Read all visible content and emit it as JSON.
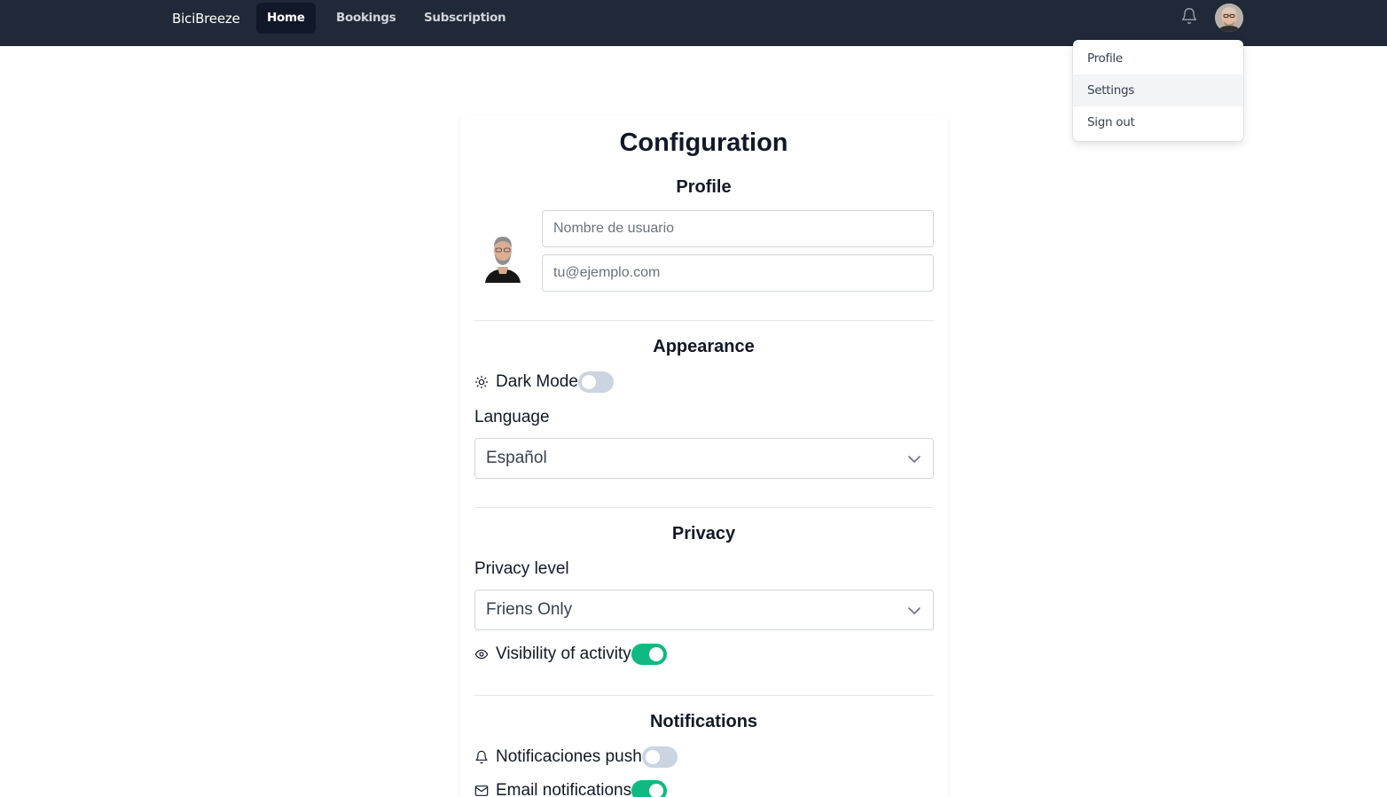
{
  "navbar": {
    "brand": "BiciBreeze",
    "links": [
      {
        "label": "Home",
        "active": true
      },
      {
        "label": "Bookings",
        "active": false
      },
      {
        "label": "Subscription",
        "active": false
      }
    ],
    "icons": {
      "notification": "bell-icon",
      "user": "avatar"
    }
  },
  "user_menu": {
    "items": [
      "Profile",
      "Settings",
      "Sign out"
    ],
    "highlighted": "Settings"
  },
  "page": {
    "title": "Configuration",
    "profile": {
      "heading": "Profile",
      "username_placeholder": "Nombre de usuario",
      "email_placeholder": "tu@ejemplo.com"
    },
    "appearance": {
      "heading": "Appearance",
      "dark_mode_label": "Dark Mode",
      "dark_mode_on": false,
      "dark_mode_icon": "sun-icon",
      "language_label": "Language",
      "language_value": "Español"
    },
    "privacy": {
      "heading": "Privacy",
      "level_label": "Privacy level",
      "level_value": "Friens Only",
      "visibility_label": "Visibility of activity",
      "visibility_on": true,
      "visibility_icon": "eye-icon"
    },
    "notifications": {
      "heading": "Notifications",
      "push_label": "Notificaciones push",
      "push_on": false,
      "push_icon": "bell-icon",
      "email_label": "Email notifications",
      "email_on": true,
      "email_icon": "mail-icon"
    }
  },
  "colors": {
    "navbar_bg": "#1f2937",
    "active_link_bg": "#111827",
    "toggle_on": "#10b981",
    "toggle_off": "#cbd5e1"
  }
}
